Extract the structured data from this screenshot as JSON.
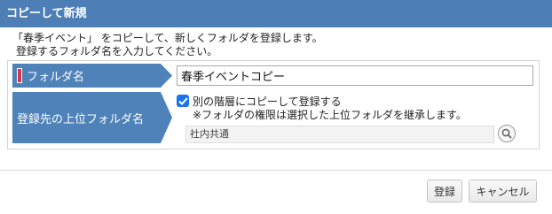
{
  "dialog": {
    "title": "コピーして新規",
    "description_line1": "「春季イベント」 をコピーして、新しくフォルダを登録します。",
    "description_line2": "登録するフォルダ名を入力してください。"
  },
  "form": {
    "folder_name": {
      "label": "フォルダ名",
      "required": true,
      "value": "春季イベントコピー"
    },
    "parent_folder": {
      "label": "登録先の上位フォルダ名",
      "checkbox_label": "別の階層にコピーして登録する",
      "checkbox_checked": true,
      "note": "※フォルダの権限は選択した上位フォルダを継承します。",
      "value": "社内共通",
      "search_icon": "search-icon"
    }
  },
  "buttons": {
    "register": "登録",
    "cancel": "キャンセル"
  },
  "colors": {
    "title_bar": "#4d7fb6",
    "label_bg": "#4f82b9",
    "required_marker": "#d9334b",
    "checkbox": "#1a73e8"
  }
}
